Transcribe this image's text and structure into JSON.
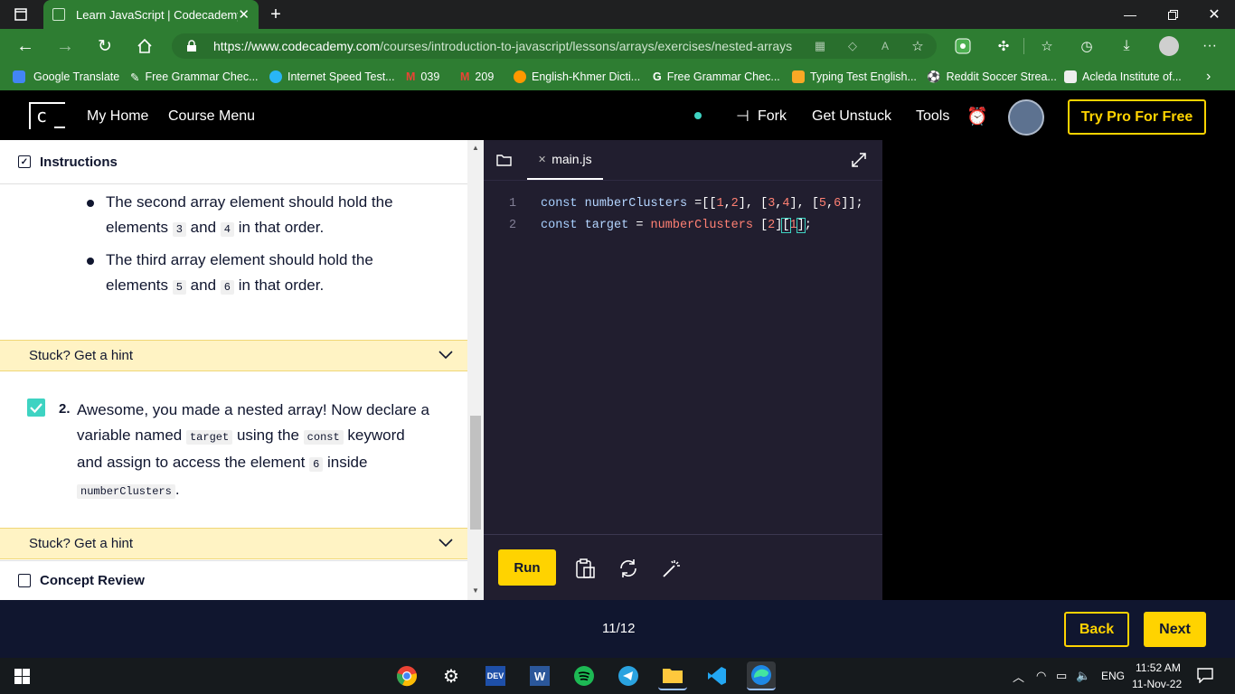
{
  "browser": {
    "tab_title": "Learn JavaScript | Codecademy",
    "url_host": "https://www.codecademy.com",
    "url_path": "/courses/introduction-to-javascript/lessons/arrays/exercises/nested-arrays",
    "accent": "#2e7d32"
  },
  "bookmarks": [
    {
      "label": "Google Translate"
    },
    {
      "label": "Free Grammar Chec..."
    },
    {
      "label": "Internet Speed Test..."
    },
    {
      "label": "039"
    },
    {
      "label": "209"
    },
    {
      "label": "English-Khmer Dicti..."
    },
    {
      "label": "Free Grammar Chec..."
    },
    {
      "label": "Typing Test English..."
    },
    {
      "label": "Reddit Soccer Strea..."
    },
    {
      "label": "Acleda Institute of..."
    }
  ],
  "nav": {
    "logo": "c",
    "my_home": "My Home",
    "course_menu": "Course Menu",
    "fork": "Fork",
    "get_unstuck": "Get Unstuck",
    "tools": "Tools",
    "try_pro": "Try Pro For Free"
  },
  "instructions": {
    "header": "Instructions",
    "bullet1_a": "The second array element should hold the",
    "bullet1_b": "elements",
    "bullet1_n1": "3",
    "bullet1_and": "and",
    "bullet1_n2": "4",
    "bullet1_c": "in that order.",
    "bullet2_a": "The third array element should hold the",
    "bullet2_b": "elements",
    "bullet2_n1": "5",
    "bullet2_and": "and",
    "bullet2_n2": "6",
    "bullet2_c": "in that order.",
    "hint_label": "Stuck? Get a hint",
    "task_number": "2.",
    "task_l1": "Awesome, you made a nested array! Now declare a",
    "task_l2a": "variable named",
    "task_code1": "target",
    "task_l2b": "using the",
    "task_code2": "const",
    "task_l2c": "keyword",
    "task_l3a": "and assign to access the element",
    "task_code3": "6",
    "task_l3b": "inside",
    "task_code4": "numberClusters",
    "task_l4": ".",
    "hint_label2": "Stuck? Get a hint",
    "concept_review": "Concept Review"
  },
  "editor": {
    "file_tab": "main.js",
    "lines": [
      {
        "num": "1"
      },
      {
        "num": "2"
      }
    ],
    "run_label": "Run"
  },
  "footer": {
    "progress": "11/12",
    "back": "Back",
    "next": "Next"
  },
  "taskbar": {
    "lang": "ENG",
    "time": "11:52 AM",
    "date": "11-Nov-22"
  }
}
